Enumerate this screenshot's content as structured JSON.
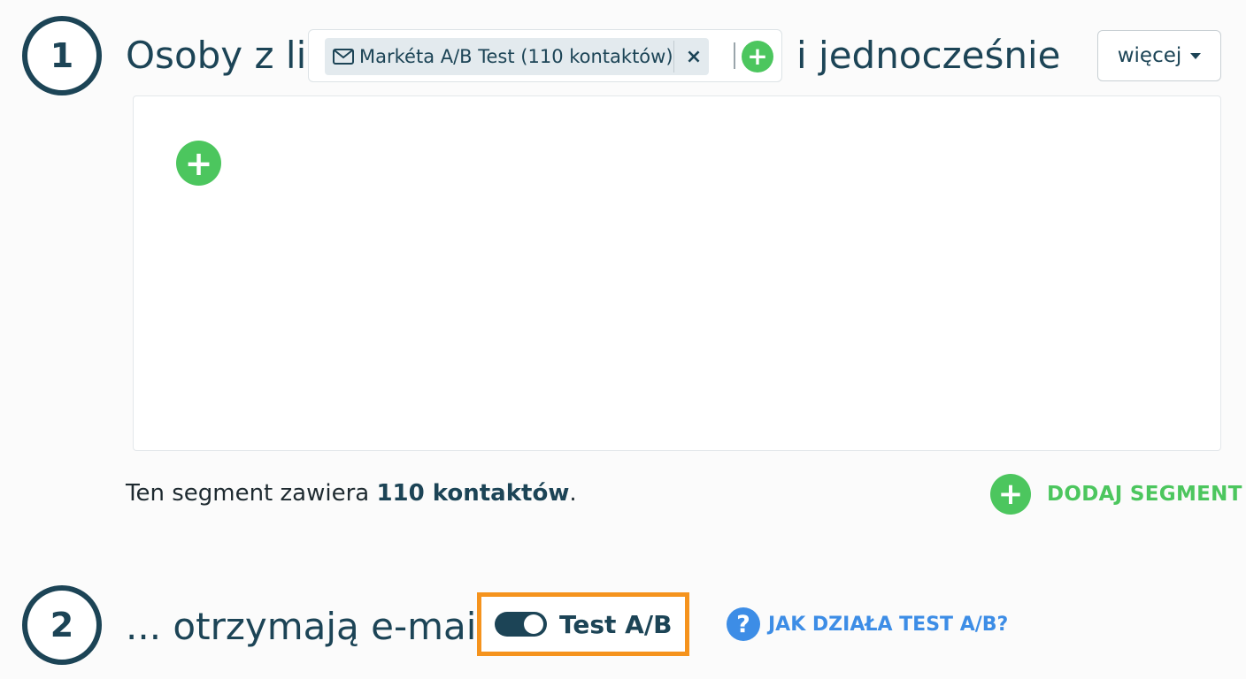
{
  "step1": {
    "number": "1",
    "heading_prefix": "Osoby z list",
    "heading_suffix": "i jednocześnie",
    "list_tag": {
      "icon": "envelope-icon",
      "label": "Markéta A/B Test (110 kontaktów)",
      "remove_symbol": "×"
    },
    "add_list_symbol": "+",
    "more_dropdown": {
      "label": "więcej",
      "icon": "caret-down-icon"
    },
    "panel_add_symbol": "+",
    "segment_info": {
      "prefix": "Ten segment zawiera ",
      "count": "110 kontaktów",
      "suffix": "."
    },
    "add_segment": {
      "symbol": "+",
      "label": "DODAJ SEGMENT"
    }
  },
  "step2": {
    "number": "2",
    "heading": "... otrzymają e-mail.",
    "ab_toggle": {
      "label": "Test A/B",
      "enabled": true
    },
    "help": {
      "symbol": "?",
      "label": "JAK DZIAŁA TEST A/B?"
    }
  },
  "colors": {
    "primary": "#1c4456",
    "green": "#4cc65e",
    "blue": "#3d8de6",
    "highlight": "#f5931d"
  }
}
